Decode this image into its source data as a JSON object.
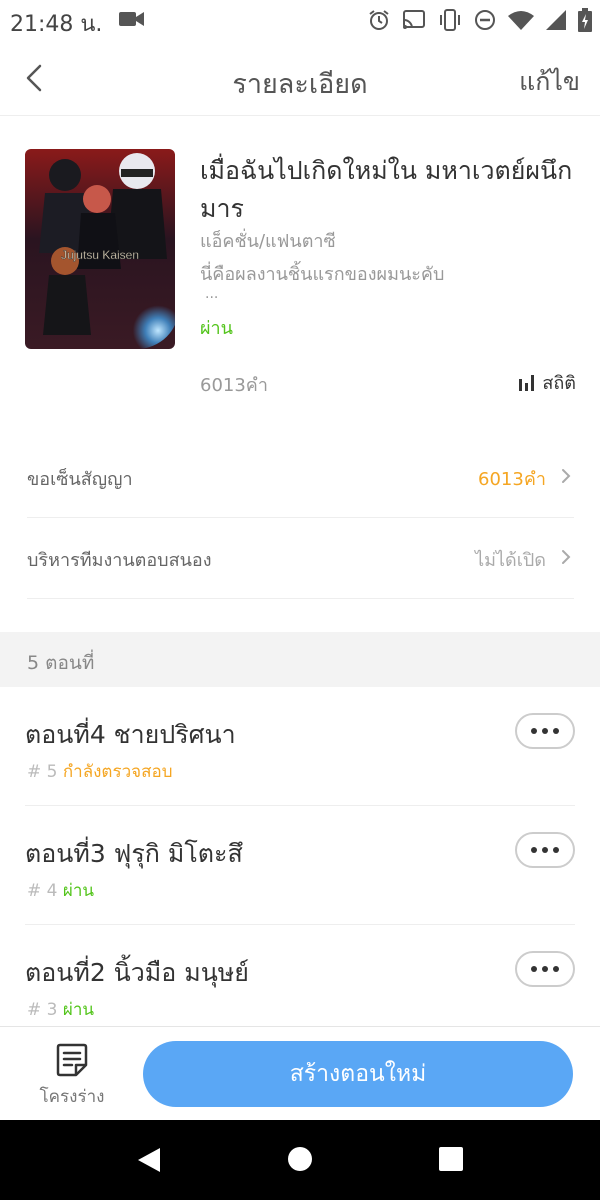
{
  "status_bar": {
    "time": "21:48 น."
  },
  "header": {
    "title": "รายละเอียด",
    "edit_label": "แก้ไข"
  },
  "book": {
    "title": "เมื่อฉันไปเกิดใหม่ใน มหาเวตย์ผนึกมาร",
    "genre": "แอ็คชั่น/แฟนตาซี",
    "description": "นี่คือผลงานชิ้นแรกของผมนะคับ",
    "ellipsis": "...",
    "status": "ผ่าน",
    "word_count": "6013คำ",
    "stats_label": "สถิติ",
    "cover_text": "Jujutsu Kaisen"
  },
  "settings": {
    "contract": {
      "label": "ขอเซ็นสัญญา",
      "value": "6013คำ"
    },
    "team": {
      "label": "บริหารทีมงานตอบสนอง",
      "value": "ไม่ได้เปิด"
    }
  },
  "chapters_header": "5 ตอนที่",
  "chapters": [
    {
      "title": "ตอนที่4 ชายปริศนา",
      "number": "# 5",
      "status": "กำลังตรวจสอบ"
    },
    {
      "title": "ตอนที่3 ฟุรุกิ มิโตะสึ",
      "number": "# 4",
      "status": "ผ่าน"
    },
    {
      "title": "ตอนที่2 นิ้วมือ มนุษย์",
      "number": "# 3",
      "status": "ผ่าน"
    }
  ],
  "bottom_bar": {
    "draft_label": "โครงร่าง",
    "create_label": "สร้างตอนใหม่"
  },
  "colors": {
    "accent_blue": "#5aa7f5",
    "pass_green": "#52c41a",
    "review_orange": "#f5a623"
  }
}
